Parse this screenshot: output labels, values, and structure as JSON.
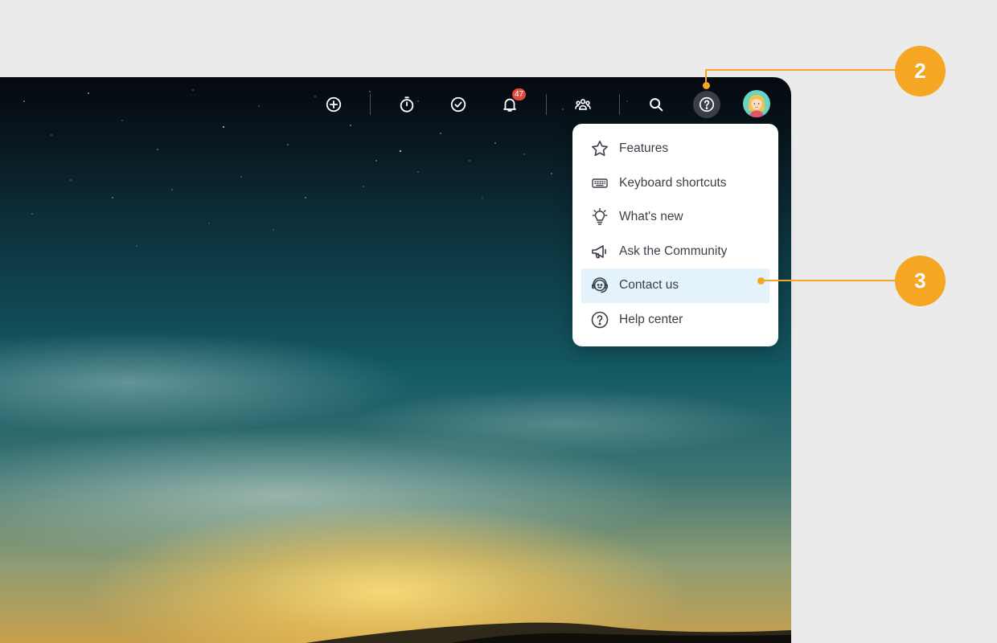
{
  "toolbar": {
    "icons": [
      "add-icon",
      "timer-icon",
      "check-circle-icon",
      "bell-icon",
      "team-icon",
      "search-icon",
      "help-icon",
      "avatar"
    ],
    "notification_count": "47"
  },
  "help_menu": {
    "items": [
      {
        "label": "Features",
        "icon": "star-icon"
      },
      {
        "label": "Keyboard shortcuts",
        "icon": "keyboard-icon"
      },
      {
        "label": "What's new",
        "icon": "lightbulb-icon"
      },
      {
        "label": "Ask the Community",
        "icon": "megaphone-icon"
      },
      {
        "label": "Contact us",
        "icon": "headset-icon",
        "highlighted": true
      },
      {
        "label": "Help center",
        "icon": "question-circle-icon"
      }
    ]
  },
  "callouts": {
    "help": "2",
    "contact": "3"
  },
  "colors": {
    "callout": "#f5a623",
    "badge": "#e24b3b",
    "menu_highlight": "#e3f2fb",
    "page_background": "#ebebeb"
  }
}
